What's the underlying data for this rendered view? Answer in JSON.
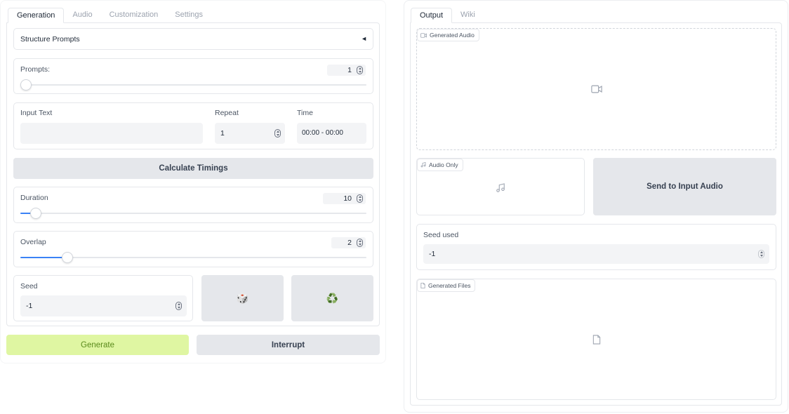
{
  "left": {
    "tabs": [
      "Generation",
      "Audio",
      "Customization",
      "Settings"
    ],
    "structure_prompts": {
      "label": "Structure Prompts",
      "toggle": "◄"
    },
    "prompts": {
      "label": "Prompts:",
      "value": "1",
      "fraction": 0.0
    },
    "input_row": {
      "input_text_label": "Input Text",
      "input_text_value": "",
      "repeat_label": "Repeat",
      "repeat_value": "1",
      "time_label": "Time",
      "time_value": "00:00 - 00:00"
    },
    "calculate_label": "Calculate Timings",
    "duration": {
      "label": "Duration",
      "value": "10",
      "fraction": 0.045
    },
    "overlap": {
      "label": "Overlap",
      "value": "2",
      "fraction": 0.135
    },
    "seed": {
      "label": "Seed",
      "value": "-1"
    },
    "dice_icon": "🎲",
    "recycle_icon": "♻️",
    "generate_label": "Generate",
    "interrupt_label": "Interrupt"
  },
  "right": {
    "tabs": [
      "Output",
      "Wiki"
    ],
    "generated_audio_label": "Generated Audio",
    "audio_only_label": "Audio Only",
    "send_label": "Send to Input Audio",
    "seed_used": {
      "label": "Seed used",
      "value": "-1"
    },
    "generated_files_label": "Generated Files"
  },
  "colors": {
    "accent": "#3b82f6",
    "generate_bg": "#dff6a2",
    "generate_text": "#5a8a1b",
    "button_bg": "#e5e7eb"
  }
}
